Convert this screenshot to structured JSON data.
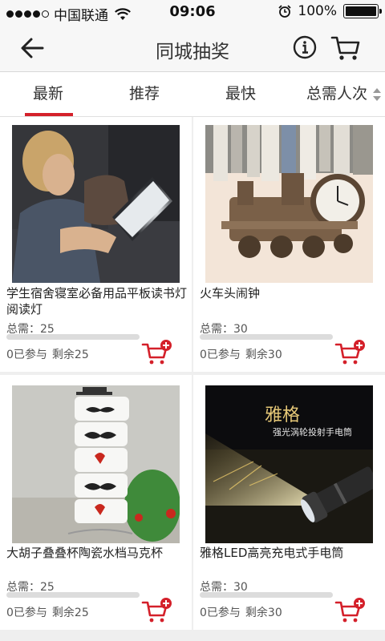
{
  "status_bar": {
    "carrier": "中国联通",
    "time": "09:06",
    "battery": "100%",
    "signal_level": 4,
    "battery_level": 1.0
  },
  "header": {
    "title": "同城抽奖",
    "back_icon": "arrow-left-icon",
    "info_icon": "info-circle-icon",
    "cart_icon": "shopping-cart-icon"
  },
  "tabs": [
    {
      "label": "最新",
      "active": true
    },
    {
      "label": "推荐",
      "active": false
    },
    {
      "label": "最快",
      "active": false
    },
    {
      "label": "总需人次",
      "active": false
    }
  ],
  "accent_color": "#d4202a",
  "products": [
    {
      "name": "学生宿舍寝室必备用品平板读书灯阅读灯",
      "need_label": "总需：",
      "need": "25",
      "joined": "0已参与",
      "remaining": "剩余25",
      "progress": 0
    },
    {
      "name": "火车头闹钟",
      "need_label": "总需：",
      "need": "30",
      "joined": "0已参与",
      "remaining": "剩余30",
      "progress": 0
    },
    {
      "name": "大胡子叠叠杯陶瓷水档马克杯",
      "need_label": "总需：",
      "need": "25",
      "joined": "0已参与",
      "remaining": "剩余25",
      "progress": 0
    },
    {
      "name": "雅格LED高亮充电式手电筒",
      "need_label": "总需：",
      "need": "30",
      "joined": "0已参与",
      "remaining": "剩余30",
      "progress": 0,
      "image_text": {
        "brand": "雅格",
        "tagline": "强光涡轮投射手电筒"
      }
    }
  ]
}
